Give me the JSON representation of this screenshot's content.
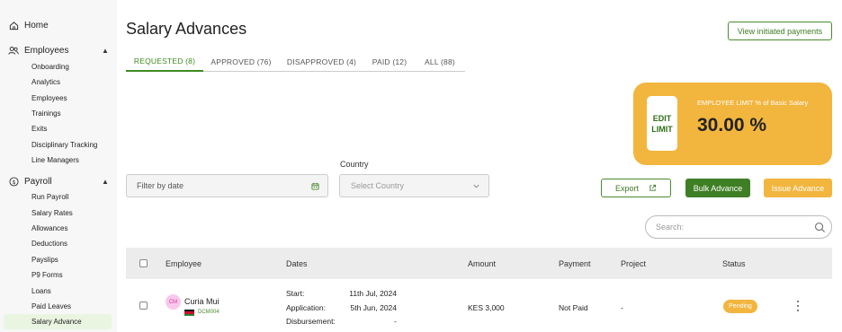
{
  "sidebar": {
    "home": "Home",
    "employees": {
      "label": "Employees",
      "items": [
        "Onboarding",
        "Analytics",
        "Employees",
        "Trainings",
        "Exits",
        "Disciplinary Tracking",
        "Line Managers"
      ]
    },
    "payroll": {
      "label": "Payroll",
      "items": [
        "Run Payroll",
        "Salary Rates",
        "Allowances",
        "Deductions",
        "Payslips",
        "P9 Forms",
        "Loans",
        "Paid Leaves",
        "Salary Advance"
      ]
    },
    "active_item": "Salary Advance"
  },
  "page": {
    "title": "Salary Advances",
    "view_initiated_label": "View initiated payments"
  },
  "tabs": [
    {
      "label": "REQUESTED (8)",
      "active": true
    },
    {
      "label": "APPROVED (76)",
      "active": false
    },
    {
      "label": "DISAPPROVED (4)",
      "active": false
    },
    {
      "label": "PAID (12)",
      "active": false
    },
    {
      "label": "ALL (88)",
      "active": false
    }
  ],
  "limit_card": {
    "edit_line1": "EDIT",
    "edit_line2": "LIMIT",
    "label": "EMPLOYEE LIMIT % of Basic Salary",
    "value": "30.00 %",
    "color": "#f2b53e"
  },
  "filters": {
    "date_placeholder": "Filter by date",
    "country_label": "Country",
    "country_placeholder": "Select Country"
  },
  "actions": {
    "export_label": "Export",
    "bulk_label": "Bulk Advance",
    "issue_label": "Issue Advance"
  },
  "search": {
    "placeholder": "Search:"
  },
  "table": {
    "columns": [
      "Employee",
      "Dates",
      "Amount",
      "Payment",
      "Project",
      "Status"
    ],
    "rows": [
      {
        "initials": "CM",
        "name": "Curia Mui",
        "code": "DCM004",
        "dates": [
          {
            "label": "Start:",
            "value": "11th Jul, 2024"
          },
          {
            "label": "Application:",
            "value": "5th Jun, 2024"
          },
          {
            "label": "Disbursement:",
            "value": "-"
          }
        ],
        "amount": "KES 3,000",
        "payment": "Not Paid",
        "project": "-",
        "status": "Pending"
      }
    ]
  },
  "colors": {
    "brand_green": "#3e7f25",
    "accent_amber": "#f2b53e"
  }
}
